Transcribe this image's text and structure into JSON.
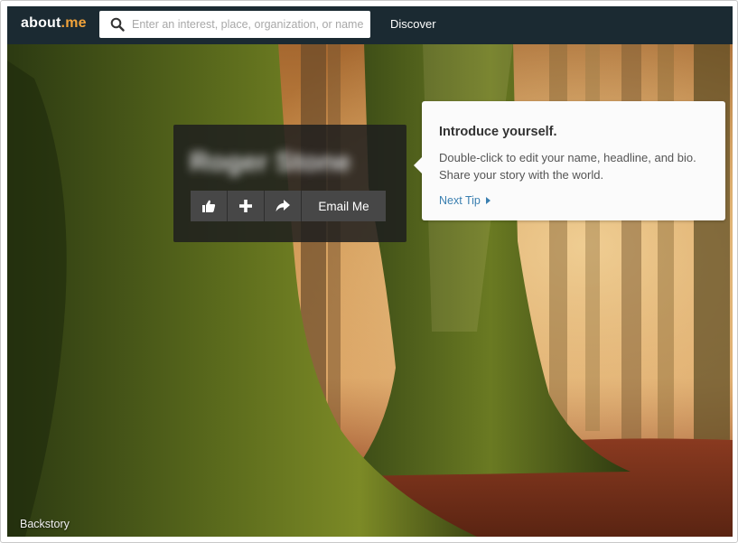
{
  "navbar": {
    "logo": {
      "text_about": "about",
      "text_me": ".me"
    },
    "search": {
      "placeholder": "Enter an interest, place, organization, or name",
      "icon": "search-icon",
      "value": ""
    },
    "discover_label": "Discover"
  },
  "profile_card": {
    "name_blurred": "Roger Stone",
    "actions": {
      "like_icon": "thumbs-up-icon",
      "add_icon": "plus-icon",
      "share_icon": "share-arrow-icon",
      "email_label": "Email Me"
    }
  },
  "tooltip": {
    "title": "Introduce yourself.",
    "body": "Double-click to edit your name, headline, and bio. Share your story with the world.",
    "next_label": "Next Tip"
  },
  "footer": {
    "backstory_label": "Backstory"
  },
  "colors": {
    "navbar_bg": "#1b2a32",
    "logo_accent": "#f2a33a",
    "link_blue": "#3a7fb0",
    "card_bg": "#1e1e1e"
  }
}
